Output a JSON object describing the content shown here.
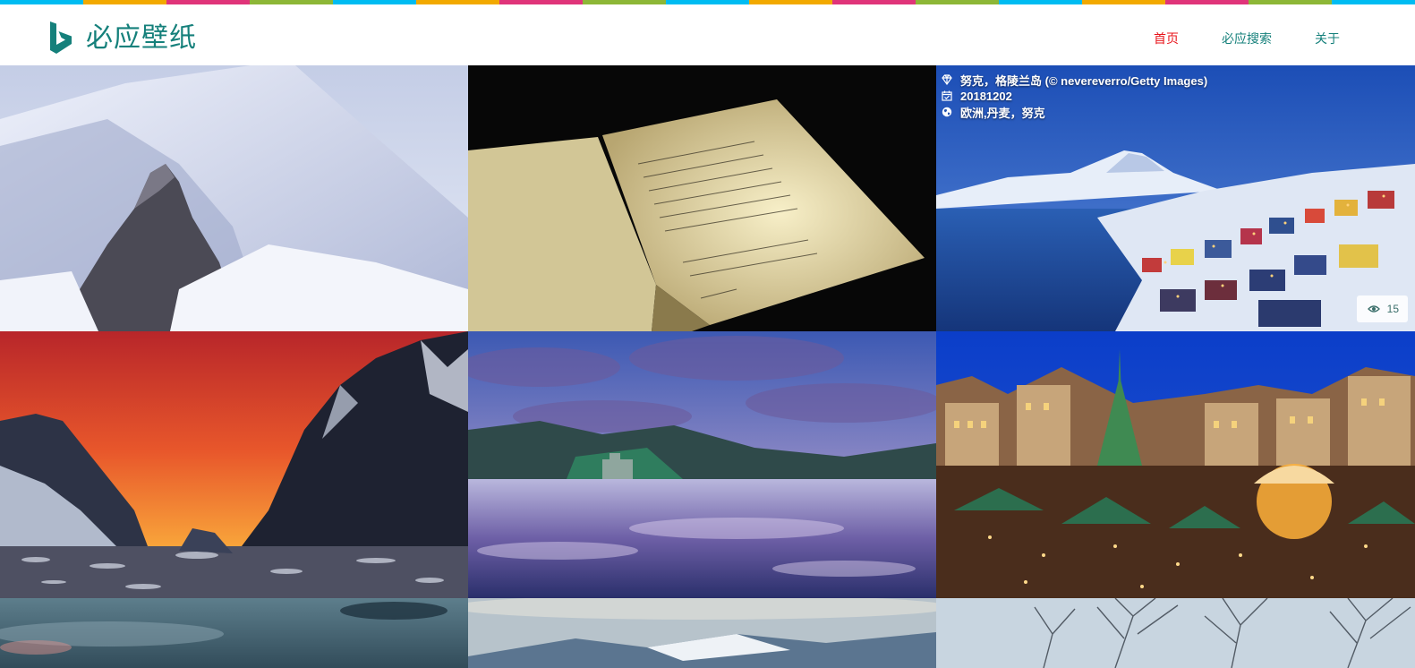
{
  "brand": {
    "title": "必应壁纸",
    "color": "#15807b"
  },
  "nav": {
    "items": [
      {
        "label": "首页",
        "active": true
      },
      {
        "label": "必应搜索",
        "active": false
      },
      {
        "label": "关于",
        "active": false
      }
    ],
    "active_color": "#e8141b",
    "color": "#15807b"
  },
  "stripe_colors": [
    "#00bcf2",
    "#f2a900",
    "#e0347a",
    "#8db737",
    "#00bcf2",
    "#f2a900",
    "#e0347a",
    "#8db737",
    "#00bcf2",
    "#f2a900",
    "#e0347a",
    "#8db737",
    "#00bcf2",
    "#f2a900",
    "#e0347a",
    "#8db737",
    "#00bcf2"
  ],
  "wallpapers": [
    {
      "id": "w1",
      "subject": "snow-mountain-observatory"
    },
    {
      "id": "w2",
      "subject": "open-handwritten-book"
    },
    {
      "id": "w3",
      "subject": "nuuk-greenland-winter",
      "hover_info": {
        "title": "努克，格陵兰岛 (© nevereverro/Getty Images)",
        "date": "20181202",
        "tags": "欧洲,丹麦，努克",
        "icons": [
          "diamond-icon",
          "calendar-check-icon",
          "globe-icon"
        ]
      },
      "views": "15",
      "view_icon": "eye-icon"
    },
    {
      "id": "w4",
      "subject": "antarctic-sunset-fjord"
    },
    {
      "id": "w5",
      "subject": "castle-lake-reflection"
    },
    {
      "id": "w6",
      "subject": "christmas-market-night"
    },
    {
      "id": "w7",
      "subject": "cloudy-sea"
    },
    {
      "id": "w8",
      "subject": "snowy-hills"
    },
    {
      "id": "w9",
      "subject": "bare-winter-trees"
    }
  ]
}
